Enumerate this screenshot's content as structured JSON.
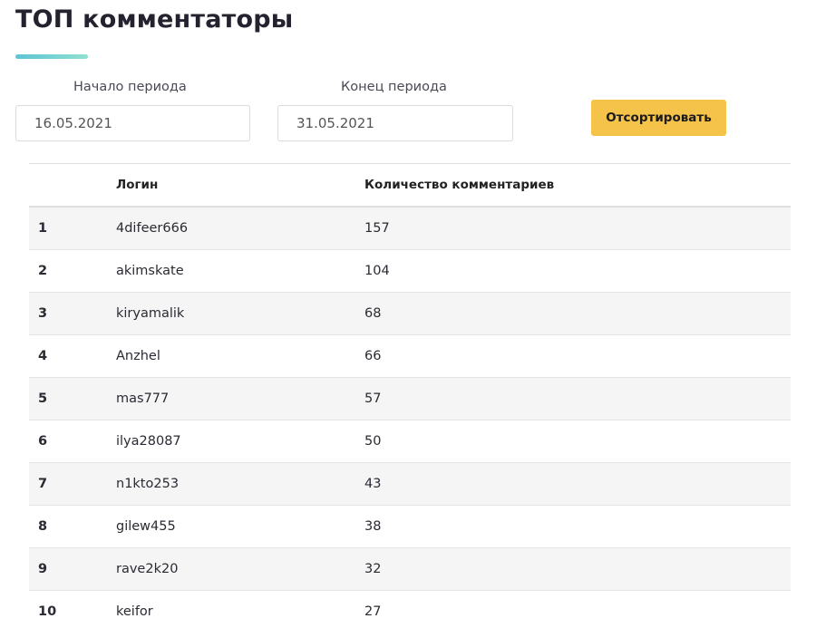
{
  "page": {
    "title": "ТОП комментаторы"
  },
  "filters": {
    "start_label": "Начало периода",
    "start_value": "16.05.2021",
    "end_label": "Конец периода",
    "end_value": "31.05.2021",
    "sort_button": "Отсортировать"
  },
  "table": {
    "headers": {
      "rank": "",
      "login": "Логин",
      "count": "Количество комментариев"
    },
    "rows": [
      {
        "rank": "1",
        "login": "4difeer666",
        "count": "157"
      },
      {
        "rank": "2",
        "login": "akimskate",
        "count": "104"
      },
      {
        "rank": "3",
        "login": "kiryamalik",
        "count": "68"
      },
      {
        "rank": "4",
        "login": "Anzhel",
        "count": "66"
      },
      {
        "rank": "5",
        "login": "mas777",
        "count": "57"
      },
      {
        "rank": "6",
        "login": "ilya28087",
        "count": "50"
      },
      {
        "rank": "7",
        "login": "n1kto253",
        "count": "43"
      },
      {
        "rank": "8",
        "login": "gilew455",
        "count": "38"
      },
      {
        "rank": "9",
        "login": "rave2k20",
        "count": "32"
      },
      {
        "rank": "10",
        "login": "keifor",
        "count": "27"
      }
    ]
  },
  "colors": {
    "accent_button": "#f5c24a",
    "underline_start": "#5ec4d6",
    "underline_end": "#8fe0d0",
    "row_stripe": "#f5f5f5"
  }
}
